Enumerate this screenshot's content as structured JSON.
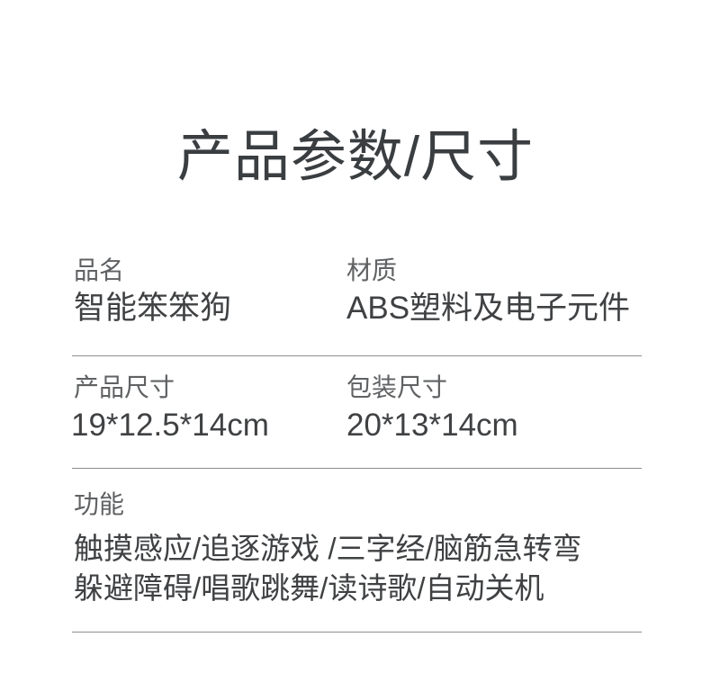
{
  "page": {
    "title": "产品参数/尺寸"
  },
  "specs": {
    "name": {
      "label": "品名",
      "value": "智能笨笨狗"
    },
    "material": {
      "label": "材质",
      "value": "ABS塑料及电子元件"
    },
    "product_size": {
      "label": "产品尺寸",
      "value": "19*12.5*14cm"
    },
    "package_size": {
      "label": "包装尺寸",
      "value": "20*13*14cm"
    },
    "functions": {
      "label": "功能",
      "lines": [
        "触摸感应/追逐游戏 /三字经/脑筋急转弯",
        "躲避障碍/唱歌跳舞/读诗歌/自动关机"
      ]
    }
  },
  "colors": {
    "background": "#ffffff",
    "title": "#3a3e41",
    "label": "#5f6163",
    "value": "#3f4143",
    "divider": "#8e8e8e"
  }
}
